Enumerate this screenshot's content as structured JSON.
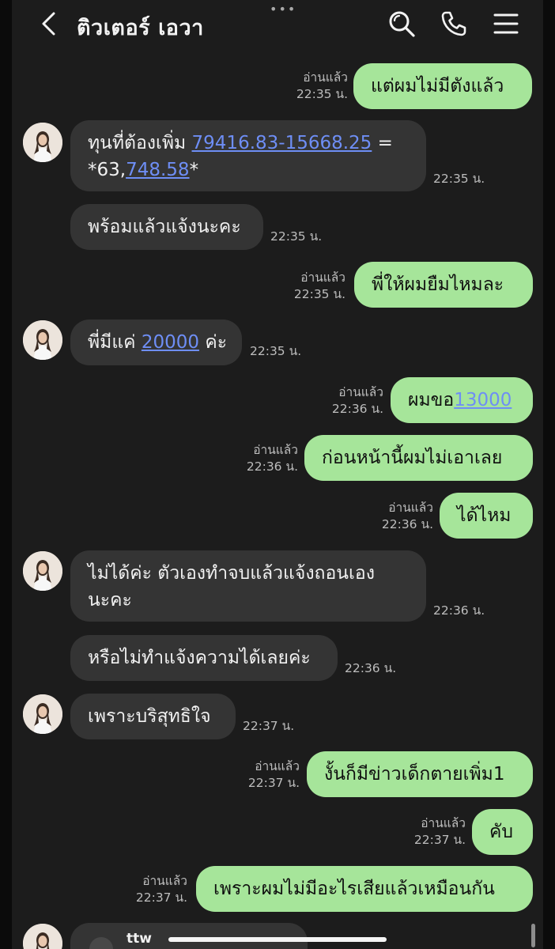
{
  "header": {
    "title": "ติวเตอร์ เอวา",
    "dots": "•••",
    "icons": [
      "chevron-left-icon",
      "search-icon",
      "phone-icon",
      "menu-icon"
    ]
  },
  "messages": [
    {
      "side": "out",
      "text": "แต่ผมไม่มีตังแล้ว",
      "read": "อ่านแล้ว",
      "time": "22:35 น."
    },
    {
      "side": "in",
      "line1_pre": "ทุนที่ต้องเพิ่ม",
      "line1_link": "79416.83-15668.25",
      "line1_post": "=",
      "line2_pre": "*63,",
      "line2_link": "748.58",
      "line2_post": "*",
      "time": "22:35 น."
    },
    {
      "side": "in",
      "text": "พร้อมแล้วแจ้งนะคะ",
      "time": "22:35 น."
    },
    {
      "side": "out",
      "text": "พี่ให้ผมยืมไหมละ",
      "read": "อ่านแล้ว",
      "time": "22:35 น."
    },
    {
      "side": "in",
      "pre": "พี่มีแค่",
      "link": "20000",
      "post": "ค่ะ",
      "time": "22:35 น."
    },
    {
      "side": "out",
      "pre": "ผมขอ",
      "link": "13000",
      "read": "อ่านแล้ว",
      "time": "22:36 น."
    },
    {
      "side": "out",
      "text": "ก่อนหน้านี้ผมไม่เอาเลย",
      "read": "อ่านแล้ว",
      "time": "22:36 น."
    },
    {
      "side": "out",
      "text": "ได้ไหม",
      "read": "อ่านแล้ว",
      "time": "22:36 น."
    },
    {
      "side": "in",
      "line1": "ไม่ได้ค่ะ ตัวเองทำจบแล้วแจ้งถอนเอง",
      "line2": "นะคะ",
      "time": "22:36 น."
    },
    {
      "side": "in",
      "text": "หรือไม่ทำแจ้งความได้เลยค่ะ",
      "time": "22:36 น."
    },
    {
      "side": "in",
      "text": "เพราะบริสุทธิใจ",
      "time": "22:37 น."
    },
    {
      "side": "out",
      "text": "งั้นก็มีข่าวเด็กตายเพิ่ม1",
      "read": "อ่านแล้ว",
      "time": "22:37 น."
    },
    {
      "side": "out",
      "text": "คับ",
      "read": "อ่านแล้ว",
      "time": "22:37 น."
    },
    {
      "side": "out",
      "text": "เพราะผมไม่มีอะไรเสียแล้วเหมือนกัน",
      "read": "อ่านแล้ว",
      "time": "22:37 น."
    },
    {
      "side": "in",
      "text": "ttw"
    }
  ],
  "colors": {
    "background": "#1c1c1c",
    "incoming_bubble": "#343434",
    "outgoing_bubble": "#a6e59a",
    "link": "#6e8ef5"
  }
}
